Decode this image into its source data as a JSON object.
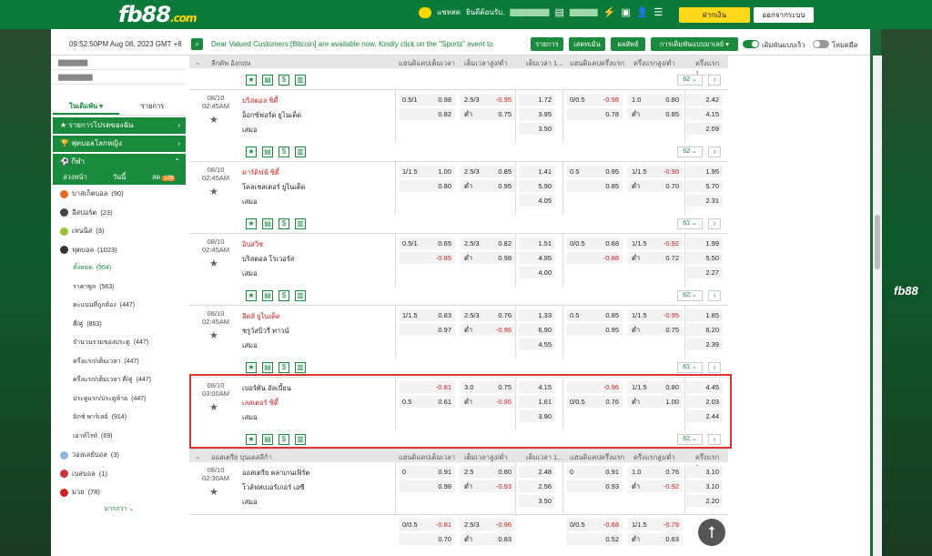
{
  "brand": {
    "logo": "fb88",
    "logo_suffix": ".com"
  },
  "header": {
    "chat": "แชทสด",
    "welcome": "ยินดีต้อนรับ,",
    "deposit": "ฝากเงิน",
    "logout": "ออกจากระบบ"
  },
  "infobar": {
    "datetime": "09:52:50PM Aug 08, 2023 GMT +8",
    "marquee": "Dear Valued Customers:[Bitcoin] are available now. Kindly click on the \"Sports\" event to",
    "btn_list": "รายการ",
    "btn_stmt": "เสตทเม้น",
    "btn_result": "ผลลัพธ์",
    "btn_betting": "การเดิมพันแบบมาเลย์",
    "toggle_fast": "เดิมพันแบบเร็ว",
    "toggle_dark": "โหมดมืด"
  },
  "sidebar": {
    "tab_active": "ในเดิมพัน",
    "tab_other": "รายการ",
    "favorites": "รายการโปรดของฉัน",
    "womens_wc": "ฟุตบอลโลกหญิง",
    "sports": "กีฬา",
    "subtabs": [
      "ล่วงหน้า",
      "วันนี้",
      "สด"
    ],
    "live_badge": "128",
    "items": [
      {
        "label": "บาสเก็ตบอล",
        "count": "(90)",
        "color": "#e86a2a"
      },
      {
        "label": "อีสปอร์ต",
        "count": "(23)",
        "color": "#444"
      },
      {
        "label": "เทนนิส",
        "count": "(3)",
        "color": "#9ac23c"
      },
      {
        "label": "ฟุตบอล",
        "count": "(1023)",
        "color": "#333"
      }
    ],
    "football_sub": [
      {
        "label": "ทั้งหมด",
        "count": "(954)"
      },
      {
        "label": "ราคาพูล",
        "count": "(563)"
      },
      {
        "label": "คะแนนที่ถูกต้อง",
        "count": "(447)"
      },
      {
        "label": "คี่/คู่",
        "count": "(863)"
      },
      {
        "label": "จำนวนรวมของประตู",
        "count": "(447)"
      },
      {
        "label": "ครึ่งแรก/เต็มเวลา",
        "count": "(447)"
      },
      {
        "label": "ครึ่งแรก/เต็มเวลา คี่/คู่",
        "count": "(447)"
      },
      {
        "label": "ประตูแรก/ประตูท้าย",
        "count": "(447)"
      },
      {
        "label": "มิกซ์ พาร์เลย์",
        "count": "(914)"
      },
      {
        "label": "เอาท์ไรท์",
        "count": "(69)"
      }
    ],
    "items2": [
      {
        "label": "วอลเลย์บอล",
        "count": "(3)",
        "color": "#8ab8e0"
      },
      {
        "label": "เบสบอล",
        "count": "(1)",
        "color": "#c33"
      },
      {
        "label": "มวย",
        "count": "(78)",
        "color": "#c22"
      }
    ],
    "more": "มากกว่า"
  },
  "columns": [
    "แฮนดิแคปเต็มเวลา",
    "เต็มเวลาสูง/ต่ำ",
    "เต็มเวลา 1...",
    "แฮนดิแคปครึ่งแรก",
    "ครึ่งแรกสูง/ต่ำ",
    "ครึ่งแรก 1..."
  ],
  "league1": "ลีกคัพ อังกฤษ",
  "league2": "ออสเตรีย บุนเดสลีก้า",
  "low": "ต่ำ",
  "draw": "เสมอ",
  "matches": [
    {
      "date": "08/10",
      "time": "02:45AM",
      "home": "บริสตอล ซิตี้",
      "away": "อ็อกซ์ฟอร์ด ยูไนเต็ด",
      "home_red": true,
      "away_red": false,
      "hdp": [
        "0.5/1",
        "0.98",
        "",
        "0.82"
      ],
      "ou": [
        "2.5/3",
        "-0.95",
        "",
        "0.75"
      ],
      "x12": [
        "1.72",
        "3.95",
        "3.50"
      ],
      "hhdp": [
        "0/0.5",
        "-0.98",
        "",
        "0.78"
      ],
      "hou": [
        "1.0",
        "0.80",
        "",
        "0.85"
      ],
      "hx12": [
        "2.42",
        "4.15",
        "2.09"
      ],
      "more": "62"
    },
    {
      "date": "08/10",
      "time": "02:45AM",
      "home": "คาร์ดิฟฟ์ ซิตี้",
      "away": "โคลเชสเตอร์ ยูไนเต็ด",
      "home_red": true,
      "away_red": false,
      "hdp": [
        "1/1.5",
        "1.00",
        "",
        "0.80"
      ],
      "ou": [
        "2.5/3",
        "0.85",
        "",
        "0.95"
      ],
      "x12": [
        "1.41",
        "5.90",
        "4.05"
      ],
      "hhdp": [
        "0.5",
        "0.95",
        "",
        "0.85"
      ],
      "hou": [
        "1/1.5",
        "-0.90",
        "",
        "0.70"
      ],
      "hx12": [
        "1.95",
        "5.70",
        "2.31"
      ],
      "more": "61"
    },
    {
      "date": "08/10",
      "time": "02:45AM",
      "home": "อิปสวิช",
      "away": "บริสตอล โรเวอร์ส",
      "home_red": true,
      "away_red": false,
      "hdp": [
        "0.5/1",
        "0.65",
        "",
        "-0.85"
      ],
      "ou": [
        "2.5/3",
        "0.82",
        "",
        "0.98"
      ],
      "x12": [
        "1.51",
        "4.95",
        "4.00"
      ],
      "hhdp": [
        "0/0.5",
        "0.68",
        "",
        "-0.88"
      ],
      "hou": [
        "1/1.5",
        "-0.92",
        "",
        "0.72"
      ],
      "hx12": [
        "1.99",
        "5.50",
        "2.27"
      ],
      "more": "62"
    },
    {
      "date": "08/10",
      "time": "02:45AM",
      "home": "ลีดส์ ยูไนเต็ด",
      "away": "ชรูว์สบิวรี่ ทาวน์",
      "home_red": true,
      "away_red": false,
      "hdp": [
        "1/1.5",
        "0.83",
        "",
        "0.97"
      ],
      "ou": [
        "2.5/3",
        "0.76",
        "",
        "-0.96"
      ],
      "x12": [
        "1.33",
        "6.90",
        "4.55"
      ],
      "hhdp": [
        "0.5",
        "0.85",
        "",
        "0.95"
      ],
      "hou": [
        "1/1.5",
        "-0.95",
        "",
        "0.75"
      ],
      "hx12": [
        "1.85",
        "6.20",
        "2.39"
      ],
      "more": "61"
    },
    {
      "date": "08/10",
      "time": "03:00AM",
      "home": "เบอร์ตัน อัลเบี้ยน",
      "away": "เลสเตอร์ ซิตี้",
      "home_red": false,
      "away_red": true,
      "hdp": [
        "",
        "-0.81",
        "0.5",
        "0.61"
      ],
      "ou": [
        "3.0",
        "0.75",
        "",
        "-0.95"
      ],
      "x12": [
        "4.15",
        "1.61",
        "3.90"
      ],
      "hhdp": [
        "",
        "-0.96",
        "0/0.5",
        "0.76"
      ],
      "hou": [
        "1/1.5",
        "0.80",
        "",
        "1.00"
      ],
      "hx12": [
        "4.45",
        "2.03",
        "2.44"
      ],
      "more": "62"
    },
    {
      "date": "08/10",
      "time": "02:30AM",
      "home": "ออสเตรีย คลาเกนเฟิร์ต",
      "away": "โวล์ฟสเบอร์เกอร์ เอซี",
      "home_red": false,
      "away_red": false,
      "hdp": [
        "0",
        "0.91",
        "",
        "0.98"
      ],
      "ou": [
        "2.5",
        "0.80",
        "",
        "-0.93"
      ],
      "x12": [
        "2.48",
        "2.56",
        "3.50"
      ],
      "hhdp": [
        "0",
        "0.91",
        "",
        "0.93"
      ],
      "hou": [
        "1.0",
        "0.76",
        "",
        "-0.92"
      ],
      "hx12": [
        "3.10",
        "3.10",
        "2.20"
      ],
      "more": ""
    }
  ],
  "extra_row": {
    "hdp": [
      "0/0.5",
      "-0.81",
      "",
      "0.70"
    ],
    "ou": [
      "2.5/3",
      "-0.96",
      "",
      "0.83"
    ],
    "hhdp": [
      "0/0.5",
      "-0.68",
      "",
      "0.52"
    ],
    "hou": [
      "1/1.5",
      "-0.79",
      "",
      "0.63"
    ]
  }
}
